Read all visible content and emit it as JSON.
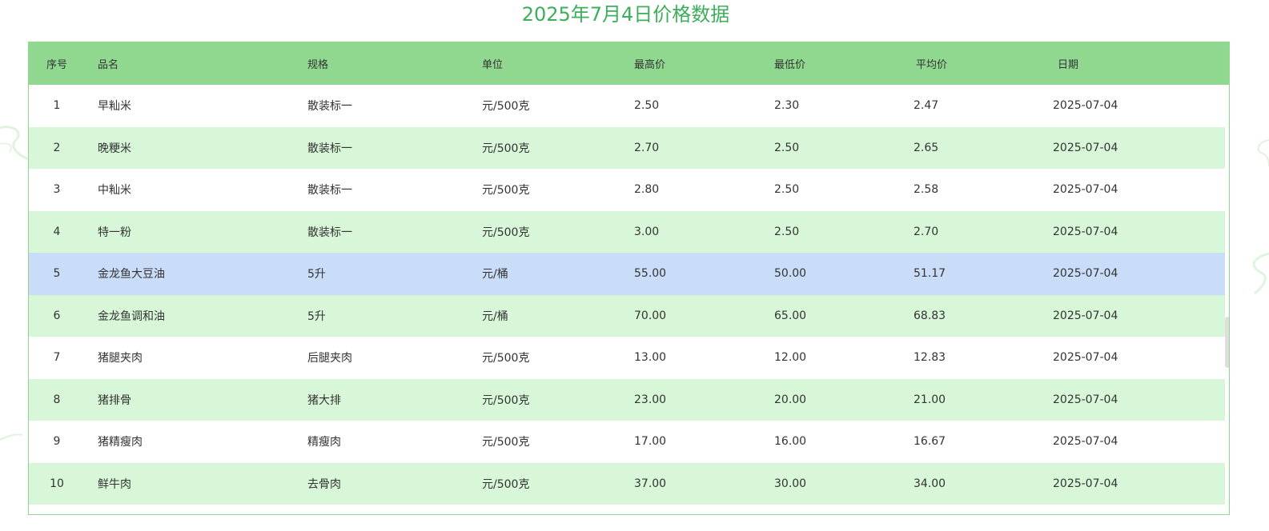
{
  "title": "2025年7月4日价格数据",
  "colors": {
    "title": "#3caf5a",
    "header_bg": "#90d890",
    "row_alt_bg": "#d8f7d8",
    "row_selected_bg": "#c9ddf8",
    "border": "#8fd68f"
  },
  "table": {
    "columns": [
      "序号",
      "品名",
      "规格",
      "单位",
      "最高价",
      "最低价",
      "平均价",
      "日期"
    ],
    "selected_row": 4,
    "rows": [
      [
        "1",
        "早籼米",
        "散装标一",
        "元/500克",
        "2.50",
        "2.30",
        "2.47",
        "2025-07-04"
      ],
      [
        "2",
        "晚粳米",
        "散装标一",
        "元/500克",
        "2.70",
        "2.50",
        "2.65",
        "2025-07-04"
      ],
      [
        "3",
        "中籼米",
        "散装标一",
        "元/500克",
        "2.80",
        "2.50",
        "2.58",
        "2025-07-04"
      ],
      [
        "4",
        "特一粉",
        "散装标一",
        "元/500克",
        "3.00",
        "2.50",
        "2.70",
        "2025-07-04"
      ],
      [
        "5",
        "金龙鱼大豆油",
        "5升",
        "元/桶",
        "55.00",
        "50.00",
        "51.17",
        "2025-07-04"
      ],
      [
        "6",
        "金龙鱼调和油",
        "5升",
        "元/桶",
        "70.00",
        "65.00",
        "68.83",
        "2025-07-04"
      ],
      [
        "7",
        "猪腿夹肉",
        "后腿夹肉",
        "元/500克",
        "13.00",
        "12.00",
        "12.83",
        "2025-07-04"
      ],
      [
        "8",
        "猪排骨",
        "猪大排",
        "元/500克",
        "23.00",
        "20.00",
        "21.00",
        "2025-07-04"
      ],
      [
        "9",
        "猪精瘦肉",
        "精瘦肉",
        "元/500克",
        "17.00",
        "16.00",
        "16.67",
        "2025-07-04"
      ],
      [
        "10",
        "鲜牛肉",
        "去骨肉",
        "元/500克",
        "37.00",
        "30.00",
        "34.00",
        "2025-07-04"
      ]
    ]
  }
}
